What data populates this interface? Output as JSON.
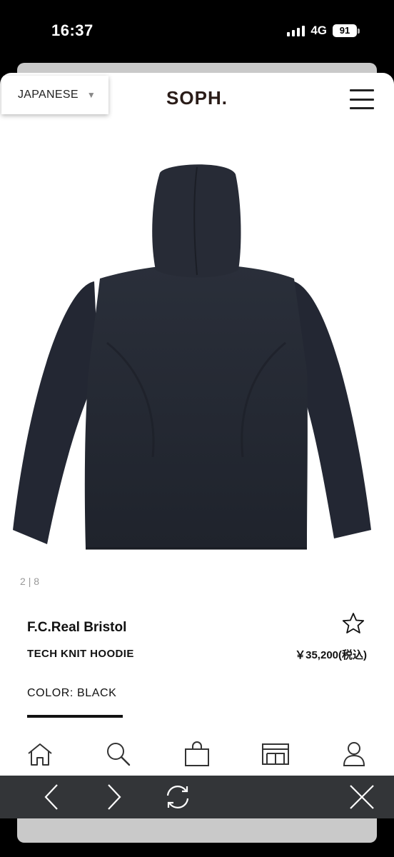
{
  "status_bar": {
    "time": "16:37",
    "network": "4G",
    "battery": "91"
  },
  "header": {
    "language": "JAPANESE",
    "language_caret": "▼",
    "logo": "SOPH."
  },
  "gallery": {
    "current": "2",
    "separator": "|",
    "total": "8"
  },
  "product": {
    "brand": "F.C.Real Bristol",
    "name": "TECH KNIT HOODIE",
    "price": "￥35,200(税込)",
    "color": "COLOR: BLACK"
  },
  "bottom_nav": [
    "home-icon",
    "search-icon",
    "bag-icon",
    "store-icon",
    "account-icon"
  ],
  "browser_toolbar": [
    "back-icon",
    "forward-icon",
    "reload-icon",
    "close-icon"
  ]
}
